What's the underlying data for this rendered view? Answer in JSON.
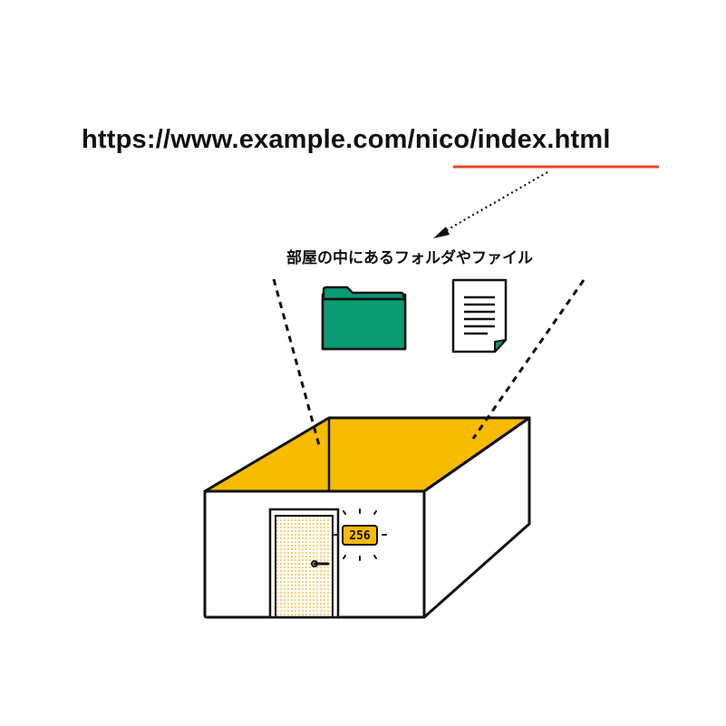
{
  "url": {
    "text": "https://www.example.com/nico/index.html",
    "highlighted_part": "nico/index.html"
  },
  "caption": "部屋の中にあるフォルダやファイル",
  "room": {
    "number": "256"
  },
  "icons": {
    "folder": "folder-icon",
    "file": "document-file-icon"
  },
  "colors": {
    "underline": "#e8452a",
    "floor": "#f7bb00",
    "folder": "#0a9b73",
    "door_pattern": "#f4c34a",
    "outline": "#111111"
  }
}
